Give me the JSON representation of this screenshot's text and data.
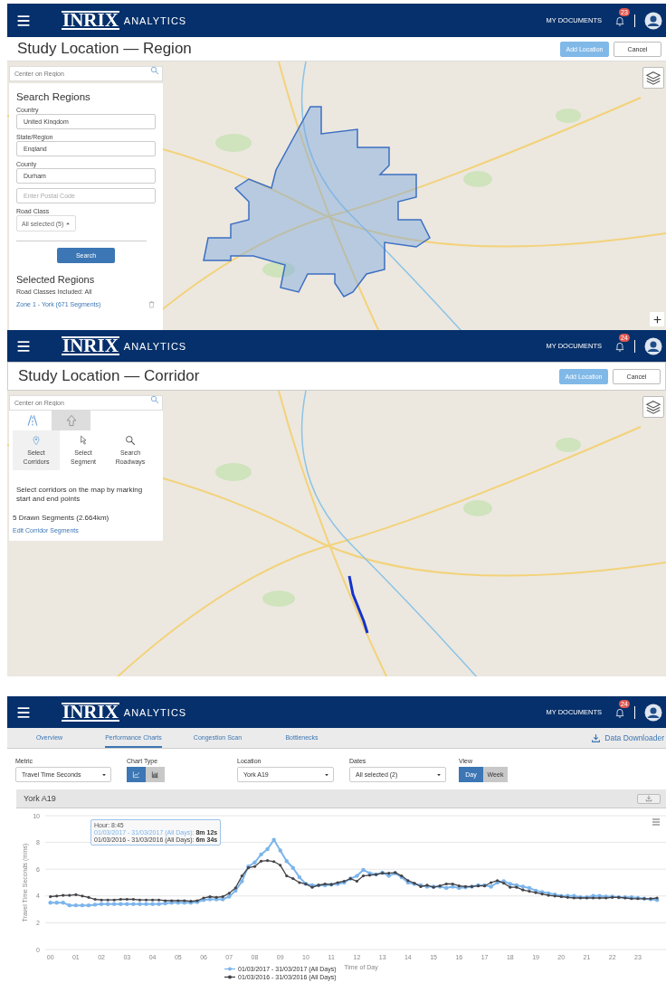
{
  "region_screen": {
    "header": {
      "logo": "INRIX",
      "product": "ANALYTICS",
      "documents_link": "MY DOCUMENTS",
      "notification_count": "23"
    },
    "title": "Study Location — Region",
    "actions": [
      {
        "label": "Add Location",
        "kind": "primary"
      },
      {
        "label": "Cancel",
        "kind": "secondary"
      }
    ],
    "map_search": {
      "placeholder": "Center on Region"
    },
    "panel": {
      "heading": "Search Regions",
      "fields": [
        {
          "label": "Country",
          "value": "United Kingdom"
        },
        {
          "label": "State/Region",
          "value": "England"
        },
        {
          "label": "County",
          "value": "Durham"
        },
        {
          "placeholder": "Enter Postal Code"
        }
      ],
      "road_class": {
        "label": "Road Class",
        "value": "All selected (5)"
      },
      "search_button": "Search",
      "selected_heading": "Selected Regions",
      "road_classes_note": "Road Classes Included: All",
      "zones": [
        "Zone 1 - York (671 Segments)"
      ]
    }
  },
  "corridor_screen": {
    "header": {
      "logo": "INRIX",
      "product": "ANALYTICS",
      "documents_link": "MY DOCUMENTS",
      "notification_count": "24"
    },
    "title": "Study Location — Corridor",
    "actions": [
      {
        "label": "Add Location",
        "kind": "primary"
      },
      {
        "label": "Cancel",
        "kind": "secondary"
      }
    ],
    "map_search": {
      "placeholder": "Center on Region"
    },
    "panel": {
      "tabs": [
        {
          "kind": "road",
          "selected": true
        },
        {
          "kind": "upload",
          "selected": false
        }
      ],
      "tools": [
        {
          "label": "Select Corridors",
          "kind": "pin",
          "selected": true
        },
        {
          "label": "Select Segment",
          "kind": "pointer",
          "selected": false
        },
        {
          "label": "Search Roadways",
          "kind": "search",
          "selected": false
        }
      ],
      "instructions": "Select corridors on the map by marking start and end points",
      "segments_summary": "5 Drawn Segments (2.664km)",
      "edit_link": "Edit Corridor Segments"
    }
  },
  "charts_screen": {
    "header": {
      "logo": "INRIX",
      "product": "ANALYTICS",
      "documents_link": "MY DOCUMENTS",
      "notification_count": "24"
    },
    "tabs": [
      {
        "label": "Overview",
        "selected": false
      },
      {
        "label": "Performance Charts",
        "selected": true
      },
      {
        "label": "Congestion Scan",
        "selected": false
      },
      {
        "label": "Bottlenecks",
        "selected": false
      }
    ],
    "downloader": "Data Downloader",
    "filters": {
      "metric": {
        "label": "Metric",
        "value": "Travel Time Seconds"
      },
      "chart_type": {
        "label": "Chart Type",
        "options": [
          {
            "kind": "line",
            "selected": true
          },
          {
            "kind": "bar",
            "selected": false
          }
        ]
      },
      "location": {
        "label": "Location",
        "value": "York A19"
      },
      "dates": {
        "label": "Dates",
        "value": "All selected (2)"
      },
      "view": {
        "label": "View",
        "options": [
          {
            "label": "Day",
            "selected": true
          },
          {
            "label": "Week",
            "selected": false
          }
        ]
      }
    },
    "chart_title": "York A19",
    "tooltip": {
      "title": "Hour: 8:45",
      "rows": [
        {
          "series": "01/03/2017 - 31/03/2017 (All Days):",
          "value": "8m 12s"
        },
        {
          "series": "01/03/2016 - 31/03/2016 (All Days):",
          "value": "6m 34s"
        }
      ]
    },
    "chart_data": {
      "type": "line",
      "grid": true,
      "legend": true,
      "xlabel": "Time of Day",
      "ylabel": "Travel Time Seconds (mins)",
      "x": [
        0,
        0.25,
        0.5,
        0.75,
        1,
        1.25,
        1.5,
        1.75,
        2,
        2.25,
        2.5,
        2.75,
        3,
        3.25,
        3.5,
        3.75,
        4,
        4.25,
        4.5,
        4.75,
        5,
        5.25,
        5.5,
        5.75,
        6,
        6.25,
        6.5,
        6.75,
        7,
        7.25,
        7.5,
        7.75,
        8,
        8.25,
        8.5,
        8.75,
        9,
        9.25,
        9.5,
        9.75,
        10,
        10.25,
        10.5,
        10.75,
        11,
        11.25,
        11.5,
        11.75,
        12,
        12.25,
        12.5,
        12.75,
        13,
        13.25,
        13.5,
        13.75,
        14,
        14.25,
        14.5,
        14.75,
        15,
        15.25,
        15.5,
        15.75,
        16,
        16.25,
        16.5,
        16.75,
        17,
        17.25,
        17.5,
        17.75,
        18,
        18.25,
        18.5,
        18.75,
        19,
        19.25,
        19.5,
        19.75,
        20,
        20.25,
        20.5,
        20.75,
        21,
        21.25,
        21.5,
        21.75,
        22,
        22.25,
        22.5,
        22.75,
        23,
        23.25,
        23.5,
        23.75
      ],
      "series": [
        {
          "name": "01/03/2017 - 31/03/2017 (All Days)",
          "color": "#7cb5ec",
          "values": [
            3.5,
            3.5,
            3.5,
            3.3,
            3.3,
            3.3,
            3.3,
            3.35,
            3.4,
            3.4,
            3.4,
            3.4,
            3.4,
            3.4,
            3.4,
            3.4,
            3.4,
            3.4,
            3.45,
            3.5,
            3.5,
            3.5,
            3.5,
            3.55,
            3.7,
            3.75,
            3.75,
            3.75,
            3.95,
            4.4,
            5.1,
            6.2,
            6.5,
            7.1,
            7.5,
            8.2,
            7.4,
            6.6,
            6.1,
            5.4,
            4.9,
            4.8,
            4.8,
            4.8,
            4.85,
            4.9,
            5.0,
            5.3,
            5.5,
            5.95,
            5.7,
            5.6,
            5.75,
            5.5,
            5.7,
            5.4,
            5.0,
            4.9,
            4.8,
            4.7,
            4.7,
            4.7,
            4.6,
            4.7,
            4.6,
            4.65,
            4.7,
            4.8,
            4.8,
            4.7,
            5.0,
            5.1,
            4.9,
            4.8,
            4.7,
            4.6,
            4.4,
            4.3,
            4.2,
            4.1,
            4.0,
            4.0,
            4.0,
            3.9,
            3.9,
            4.0,
            4.0,
            3.95,
            3.95,
            3.9,
            3.9,
            3.9,
            3.85,
            3.8,
            3.75,
            3.7
          ]
        },
        {
          "name": "01/03/2016 - 31/03/2016 (All Days)",
          "color": "#434348",
          "values": [
            3.95,
            4.0,
            4.05,
            4.05,
            4.1,
            4.0,
            3.9,
            3.75,
            3.7,
            3.7,
            3.7,
            3.75,
            3.75,
            3.75,
            3.7,
            3.7,
            3.7,
            3.7,
            3.65,
            3.65,
            3.65,
            3.65,
            3.6,
            3.65,
            3.85,
            3.95,
            3.9,
            3.95,
            4.2,
            4.6,
            5.5,
            6.1,
            6.2,
            6.6,
            6.65,
            6.57,
            6.3,
            5.5,
            5.3,
            5.0,
            4.9,
            4.65,
            4.8,
            4.9,
            4.85,
            5.0,
            5.1,
            5.3,
            5.1,
            5.5,
            5.55,
            5.6,
            5.7,
            5.7,
            5.75,
            5.5,
            5.15,
            4.95,
            4.7,
            4.8,
            4.65,
            4.75,
            4.9,
            4.9,
            4.75,
            4.7,
            4.7,
            4.75,
            4.75,
            5.0,
            5.15,
            4.95,
            4.65,
            4.65,
            4.45,
            4.35,
            4.25,
            4.15,
            4.05,
            4.0,
            3.95,
            3.9,
            3.85,
            3.85,
            3.85,
            3.85,
            3.85,
            3.85,
            3.9,
            3.9,
            3.85,
            3.8,
            3.8,
            3.8,
            3.8,
            3.85
          ]
        }
      ],
      "xlim": [
        -0.2,
        24.1
      ],
      "ylim": [
        0,
        10
      ],
      "yticks": [
        0,
        2,
        4,
        6,
        8,
        10
      ],
      "xticks": [
        {
          "value": 0,
          "label": "00"
        },
        {
          "value": 1,
          "label": "01"
        },
        {
          "value": 2,
          "label": "02"
        },
        {
          "value": 3,
          "label": "03"
        },
        {
          "value": 4,
          "label": "04"
        },
        {
          "value": 5,
          "label": "05"
        },
        {
          "value": 6,
          "label": "06"
        },
        {
          "value": 7,
          "label": "07"
        },
        {
          "value": 8,
          "label": "08"
        },
        {
          "value": 9,
          "label": "09"
        },
        {
          "value": 10,
          "label": "10"
        },
        {
          "value": 11,
          "label": "11"
        },
        {
          "value": 12,
          "label": "12"
        },
        {
          "value": 13,
          "label": "13"
        },
        {
          "value": 14,
          "label": "14"
        },
        {
          "value": 15,
          "label": "15"
        },
        {
          "value": 16,
          "label": "16"
        },
        {
          "value": 17,
          "label": "17"
        },
        {
          "value": 18,
          "label": "18"
        },
        {
          "value": 19,
          "label": "19"
        },
        {
          "value": 20,
          "label": "20"
        },
        {
          "value": 21,
          "label": "21"
        },
        {
          "value": 22,
          "label": "22"
        },
        {
          "value": 23,
          "label": "23"
        }
      ]
    }
  }
}
